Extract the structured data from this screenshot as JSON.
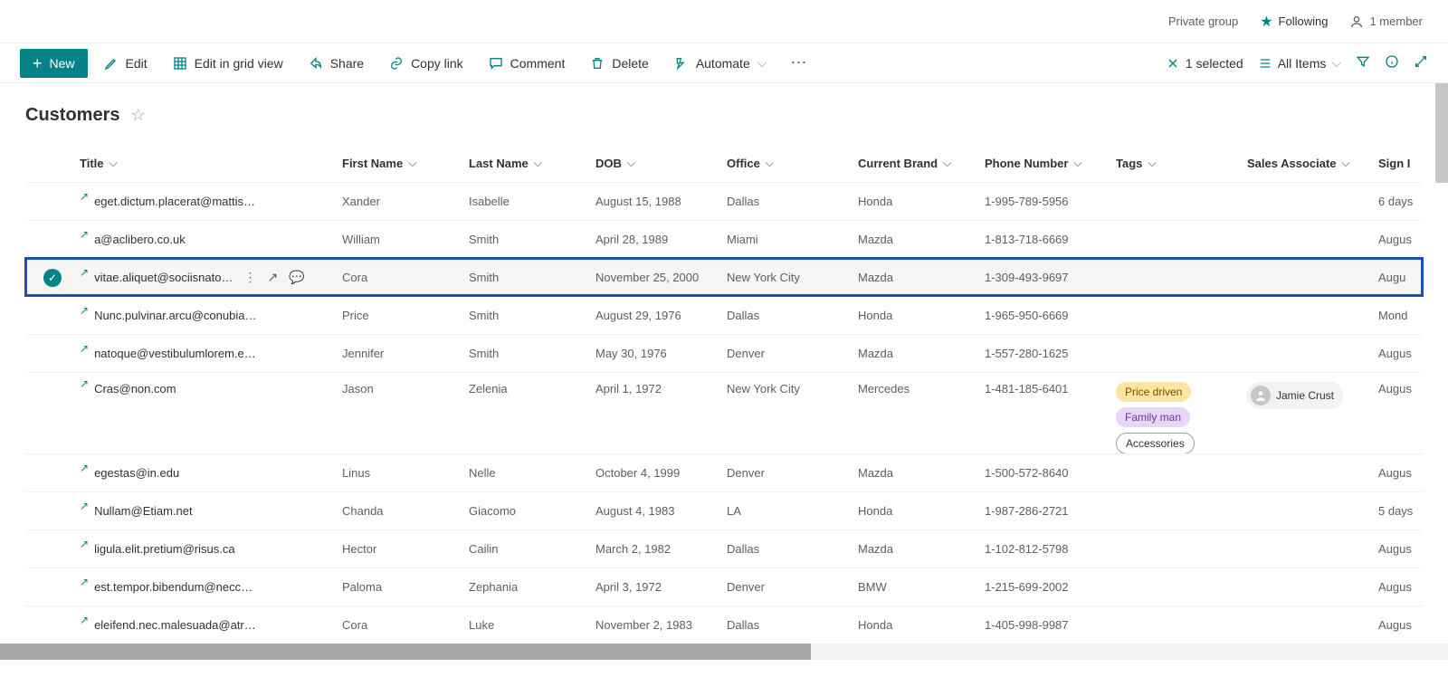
{
  "site": {
    "group_type": "Private group",
    "following": "Following",
    "members": "1 member"
  },
  "cmd": {
    "new": "New",
    "edit": "Edit",
    "grid": "Edit in grid view",
    "share": "Share",
    "copylink": "Copy link",
    "comment": "Comment",
    "delete": "Delete",
    "automate": "Automate",
    "selected": "1 selected",
    "view": "All Items"
  },
  "list": {
    "title": "Customers"
  },
  "columns": {
    "title": "Title",
    "first": "First Name",
    "last": "Last Name",
    "dob": "DOB",
    "office": "Office",
    "brand": "Current Brand",
    "phone": "Phone Number",
    "tags": "Tags",
    "assoc": "Sales Associate",
    "sign": "Sign I"
  },
  "rows": [
    {
      "selected": false,
      "title": "eget.dictum.placerat@mattis.ca",
      "first": "Xander",
      "last": "Isabelle",
      "dob": "August 15, 1988",
      "office": "Dallas",
      "brand": "Honda",
      "phone": "1-995-789-5956",
      "tags": [],
      "assoc": "",
      "sign": "6 days"
    },
    {
      "selected": false,
      "title": "a@aclibero.co.uk",
      "first": "William",
      "last": "Smith",
      "dob": "April 28, 1989",
      "office": "Miami",
      "brand": "Mazda",
      "phone": "1-813-718-6669",
      "tags": [],
      "assoc": "",
      "sign": "Augus"
    },
    {
      "selected": true,
      "title": "vitae.aliquet@sociisnato…",
      "first": "Cora",
      "last": "Smith",
      "dob": "November 25, 2000",
      "office": "New York City",
      "brand": "Mazda",
      "phone": "1-309-493-9697",
      "tags": [],
      "assoc": "",
      "sign": "Augu"
    },
    {
      "selected": false,
      "title": "Nunc.pulvinar.arcu@conubianostraper.edu",
      "first": "Price",
      "last": "Smith",
      "dob": "August 29, 1976",
      "office": "Dallas",
      "brand": "Honda",
      "phone": "1-965-950-6669",
      "tags": [],
      "assoc": "",
      "sign": "Mond"
    },
    {
      "selected": false,
      "title": "natoque@vestibulumlorem.edu",
      "first": "Jennifer",
      "last": "Smith",
      "dob": "May 30, 1976",
      "office": "Denver",
      "brand": "Mazda",
      "phone": "1-557-280-1625",
      "tags": [],
      "assoc": "",
      "sign": "Augus"
    },
    {
      "selected": false,
      "tall": true,
      "title": "Cras@non.com",
      "first": "Jason",
      "last": "Zelenia",
      "dob": "April 1, 1972",
      "office": "New York City",
      "brand": "Mercedes",
      "phone": "1-481-185-6401",
      "tags": [
        {
          "t": "Price driven",
          "c": "yellow"
        },
        {
          "t": "Family man",
          "c": "purple"
        },
        {
          "t": "Accessories",
          "c": "outline"
        }
      ],
      "assoc": "Jamie Crust",
      "sign": "Augus"
    },
    {
      "selected": false,
      "title": "egestas@in.edu",
      "first": "Linus",
      "last": "Nelle",
      "dob": "October 4, 1999",
      "office": "Denver",
      "brand": "Mazda",
      "phone": "1-500-572-8640",
      "tags": [],
      "assoc": "",
      "sign": "Augus"
    },
    {
      "selected": false,
      "title": "Nullam@Etiam.net",
      "first": "Chanda",
      "last": "Giacomo",
      "dob": "August 4, 1983",
      "office": "LA",
      "brand": "Honda",
      "phone": "1-987-286-2721",
      "tags": [],
      "assoc": "",
      "sign": "5 days"
    },
    {
      "selected": false,
      "title": "ligula.elit.pretium@risus.ca",
      "first": "Hector",
      "last": "Cailin",
      "dob": "March 2, 1982",
      "office": "Dallas",
      "brand": "Mazda",
      "phone": "1-102-812-5798",
      "tags": [],
      "assoc": "",
      "sign": "Augus"
    },
    {
      "selected": false,
      "title": "est.tempor.bibendum@neccursusa.com",
      "first": "Paloma",
      "last": "Zephania",
      "dob": "April 3, 1972",
      "office": "Denver",
      "brand": "BMW",
      "phone": "1-215-699-2002",
      "tags": [],
      "assoc": "",
      "sign": "Augus"
    },
    {
      "selected": false,
      "title": "eleifend.nec.malesuada@atrisus.ca",
      "first": "Cora",
      "last": "Luke",
      "dob": "November 2, 1983",
      "office": "Dallas",
      "brand": "Honda",
      "phone": "1-405-998-9987",
      "tags": [],
      "assoc": "",
      "sign": "Augus"
    }
  ]
}
